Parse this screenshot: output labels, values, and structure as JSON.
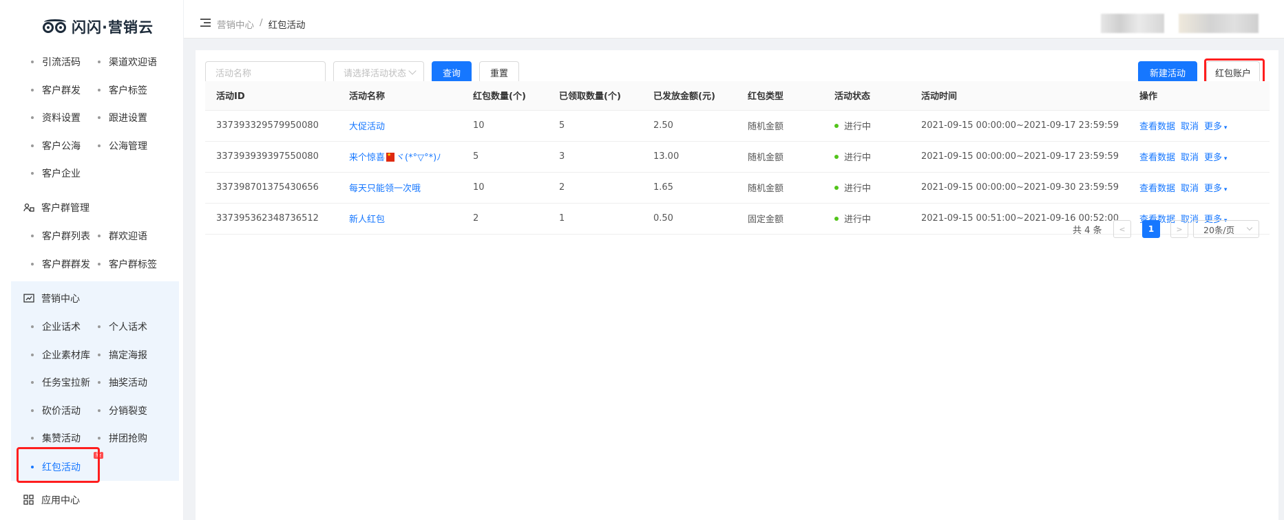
{
  "logo": {
    "text": "闪闪·营销云"
  },
  "sidebar": {
    "rows1": [
      [
        "引流活码",
        "渠道欢迎语"
      ],
      [
        "客户群发",
        "客户标签"
      ],
      [
        "资料设置",
        "跟进设置"
      ],
      [
        "客户公海",
        "公海管理"
      ],
      [
        "客户企业",
        ""
      ]
    ],
    "group_customer_group": "客户群管理",
    "rows2": [
      [
        "客户群列表",
        "群欢迎语"
      ],
      [
        "客户群群发",
        "客户群标签"
      ]
    ],
    "group_marketing": "营销中心",
    "rows3": [
      [
        "企业话术",
        "个人话术"
      ],
      [
        "企业素材库",
        "搞定海报"
      ],
      [
        "任务宝拉新",
        "抽奖活动"
      ],
      [
        "砍价活动",
        "分销裂变"
      ],
      [
        "集赞活动",
        "拼团抢购"
      ]
    ],
    "active_item": "红包活动",
    "new_badge": "新",
    "group_app": "应用中心"
  },
  "header": {
    "breadcrumb_parent": "营销中心",
    "breadcrumb_sep": "/",
    "breadcrumb_current": "红包活动"
  },
  "filters": {
    "name_placeholder": "活动名称",
    "status_placeholder": "请选择活动状态",
    "query_label": "查询",
    "reset_label": "重置",
    "new_label": "新建活动",
    "account_label": "红包账户"
  },
  "table": {
    "headers": [
      "活动ID",
      "活动名称",
      "红包数量(个)",
      "已领取数量(个)",
      "已发放金额(元)",
      "红包类型",
      "活动状态",
      "活动时间",
      "操作"
    ],
    "rows": [
      {
        "id": "337393329579950080",
        "name": "大促活动",
        "name_suffix": "",
        "count": "10",
        "received": "5",
        "amount": "2.50",
        "type": "随机金额",
        "status": "进行中",
        "time": "2021-09-15 00:00:00~2021-09-17 23:59:59"
      },
      {
        "id": "337393939397550080",
        "name": "来个惊喜",
        "name_suffix": "ヾ(*°▽°*)ﾉ",
        "count": "5",
        "received": "3",
        "amount": "13.00",
        "type": "随机金额",
        "status": "进行中",
        "time": "2021-09-15 00:00:00~2021-09-17 23:59:59"
      },
      {
        "id": "337398701375430656",
        "name": "每天只能领一次哦",
        "name_suffix": "",
        "count": "10",
        "received": "2",
        "amount": "1.65",
        "type": "随机金额",
        "status": "进行中",
        "time": "2021-09-15 00:00:00~2021-09-30 23:59:59"
      },
      {
        "id": "337395362348736512",
        "name": "新人红包",
        "name_suffix": "",
        "count": "2",
        "received": "1",
        "amount": "0.50",
        "type": "固定金额",
        "status": "进行中",
        "time": "2021-09-15 00:51:00~2021-09-16 00:52:00"
      }
    ],
    "ops": [
      "查看数据",
      "取消",
      "更多"
    ]
  },
  "pagination": {
    "total": "共 4 条",
    "prev": "<",
    "current": "1",
    "next": ">",
    "page_size": "20条/页"
  },
  "colors": {
    "primary": "#1677ff",
    "status_active": "#52c41a",
    "highlight": "#ff1e1e"
  }
}
